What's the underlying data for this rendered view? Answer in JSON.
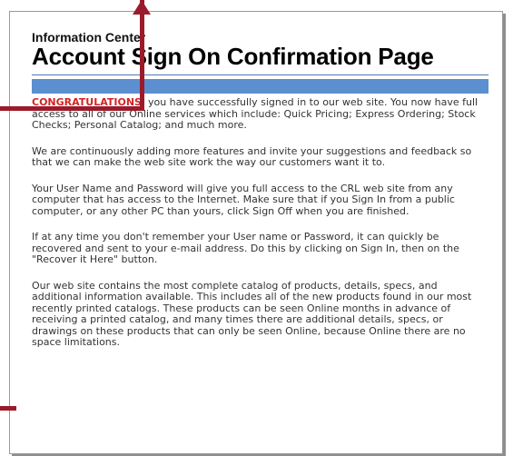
{
  "header": {
    "section_title": "Information Center",
    "page_title": "Account Sign On Confirmation Page"
  },
  "colors": {
    "accent_blue": "#5b8fd0",
    "congrats_red": "#d22424",
    "callout_maroon": "#9b1b2a"
  },
  "content": {
    "congrats_word": "CONGRATULATIONS",
    "p1_rest": ", you have successfully signed in to our web site. You now have full access to all of our Online services which include: Quick Pricing; Express Ordering; Stock Checks; Personal Catalog; and much more.",
    "p2": "We are continuously adding more features and invite your suggestions and feedback so that we can make the web site work the way our customers want it to.",
    "p3": "Your User Name and Password will give you full access to the CRL web site from any computer that has access to the Internet. Make sure that if you Sign In from a public computer, or any other PC than yours, click Sign Off when you are finished.",
    "p4": "If at any time you don't remember your User name or Password, it can quickly be recovered and sent to your e-mail address. Do this by clicking on Sign In, then on the \"Recover it Here\" button.",
    "p5": "Our web site contains the most complete catalog of products, details, specs, and additional information available. This includes all of the new products found in our most recently printed catalogs. These products can be seen Online months in advance of receiving a printed catalog, and many times there are additional details, specs, or drawings on these products that can only be seen Online, because Online there are no space limitations."
  }
}
